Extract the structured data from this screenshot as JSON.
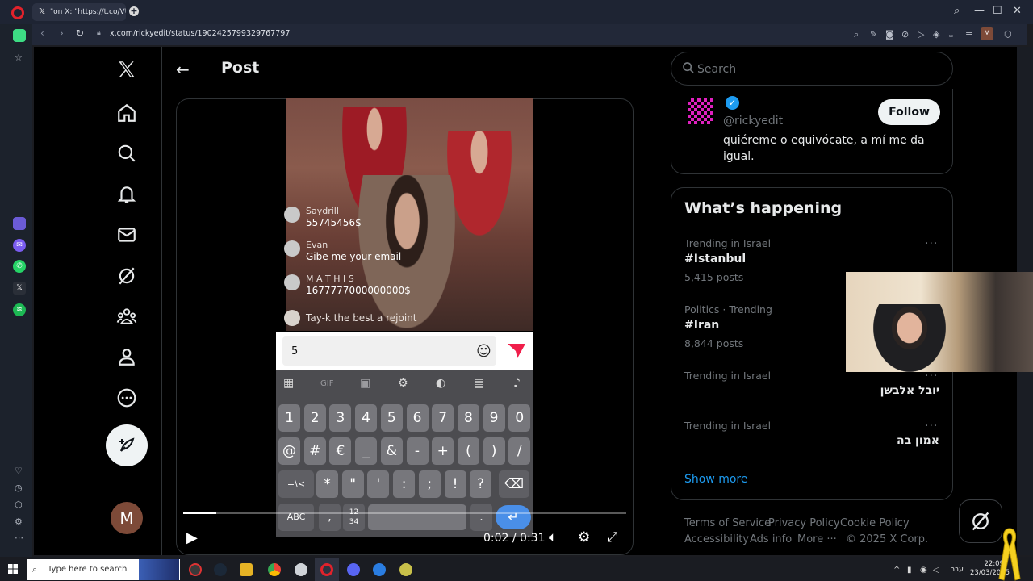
{
  "browser": {
    "tab_title": "\"on X: \"https://t.co/VUuL6",
    "tab_favicon": "𝕏",
    "new_tab": "+",
    "url": "x.com/rickyedit/status/1902425799329767797",
    "profile_initial": "M"
  },
  "x": {
    "header_title": "Post",
    "compose_label": "Post",
    "avatar_initial": "M",
    "video": {
      "chat": [
        {
          "name": "Saydrill",
          "message": "55745456$"
        },
        {
          "name": "Evan",
          "message": "Gibe me your email"
        },
        {
          "name": "M A T H I S",
          "message": "1677777000000000$"
        },
        {
          "name": "",
          "message": "Tay-k the best a rejoint"
        }
      ],
      "input_text": "5",
      "keyboard": {
        "number_row": [
          "1",
          "2",
          "3",
          "4",
          "5",
          "6",
          "7",
          "8",
          "9",
          "0"
        ],
        "symbol_row": [
          "@",
          "#",
          "€",
          "_",
          "&",
          "-",
          "+",
          "(",
          ")",
          "/"
        ],
        "third_row": [
          "=\\<",
          "*",
          "\"",
          "'",
          ":",
          ";",
          "!",
          "?"
        ],
        "abc": "ABC",
        "numpad": "12\n34",
        "gif": "GIF"
      },
      "time": "0:02 / 0:31",
      "progress": 0.074
    },
    "search_placeholder": "Search",
    "profile": {
      "handle": "@rickyedit",
      "bio": "quiéreme o equivócate, a mí me da igual.",
      "follow_label": "Follow"
    },
    "happening": {
      "title": "What’s happening",
      "trends": [
        {
          "meta": "Trending in Israel",
          "name": "#Istanbul",
          "count": "5,415 posts",
          "rtl": false
        },
        {
          "meta": "Politics · Trending",
          "name": "#Iran",
          "count": "8,844 posts",
          "rtl": false
        },
        {
          "meta": "Trending in Israel",
          "name": "יובל אלבשן",
          "count": "",
          "rtl": true
        },
        {
          "meta": "Trending in Israel",
          "name": "אמון בה",
          "count": "",
          "rtl": true
        }
      ],
      "show_more": "Show more"
    },
    "footer": {
      "terms": "Terms of Service",
      "privacy": "Privacy Policy",
      "cookie": "Cookie Policy",
      "accessibility": "Accessibility",
      "ads": "Ads info",
      "more": "More ···",
      "copyright": "© 2025 X Corp."
    }
  },
  "taskbar": {
    "search_placeholder": "Type here to search",
    "lang": "עבר",
    "time": "22:09",
    "date": "23/03/2025"
  },
  "colors": {
    "accent": "#1d9bf0",
    "background": "#000000",
    "text": "#e7e9ea",
    "muted": "#71767b",
    "border": "#2f3336"
  }
}
